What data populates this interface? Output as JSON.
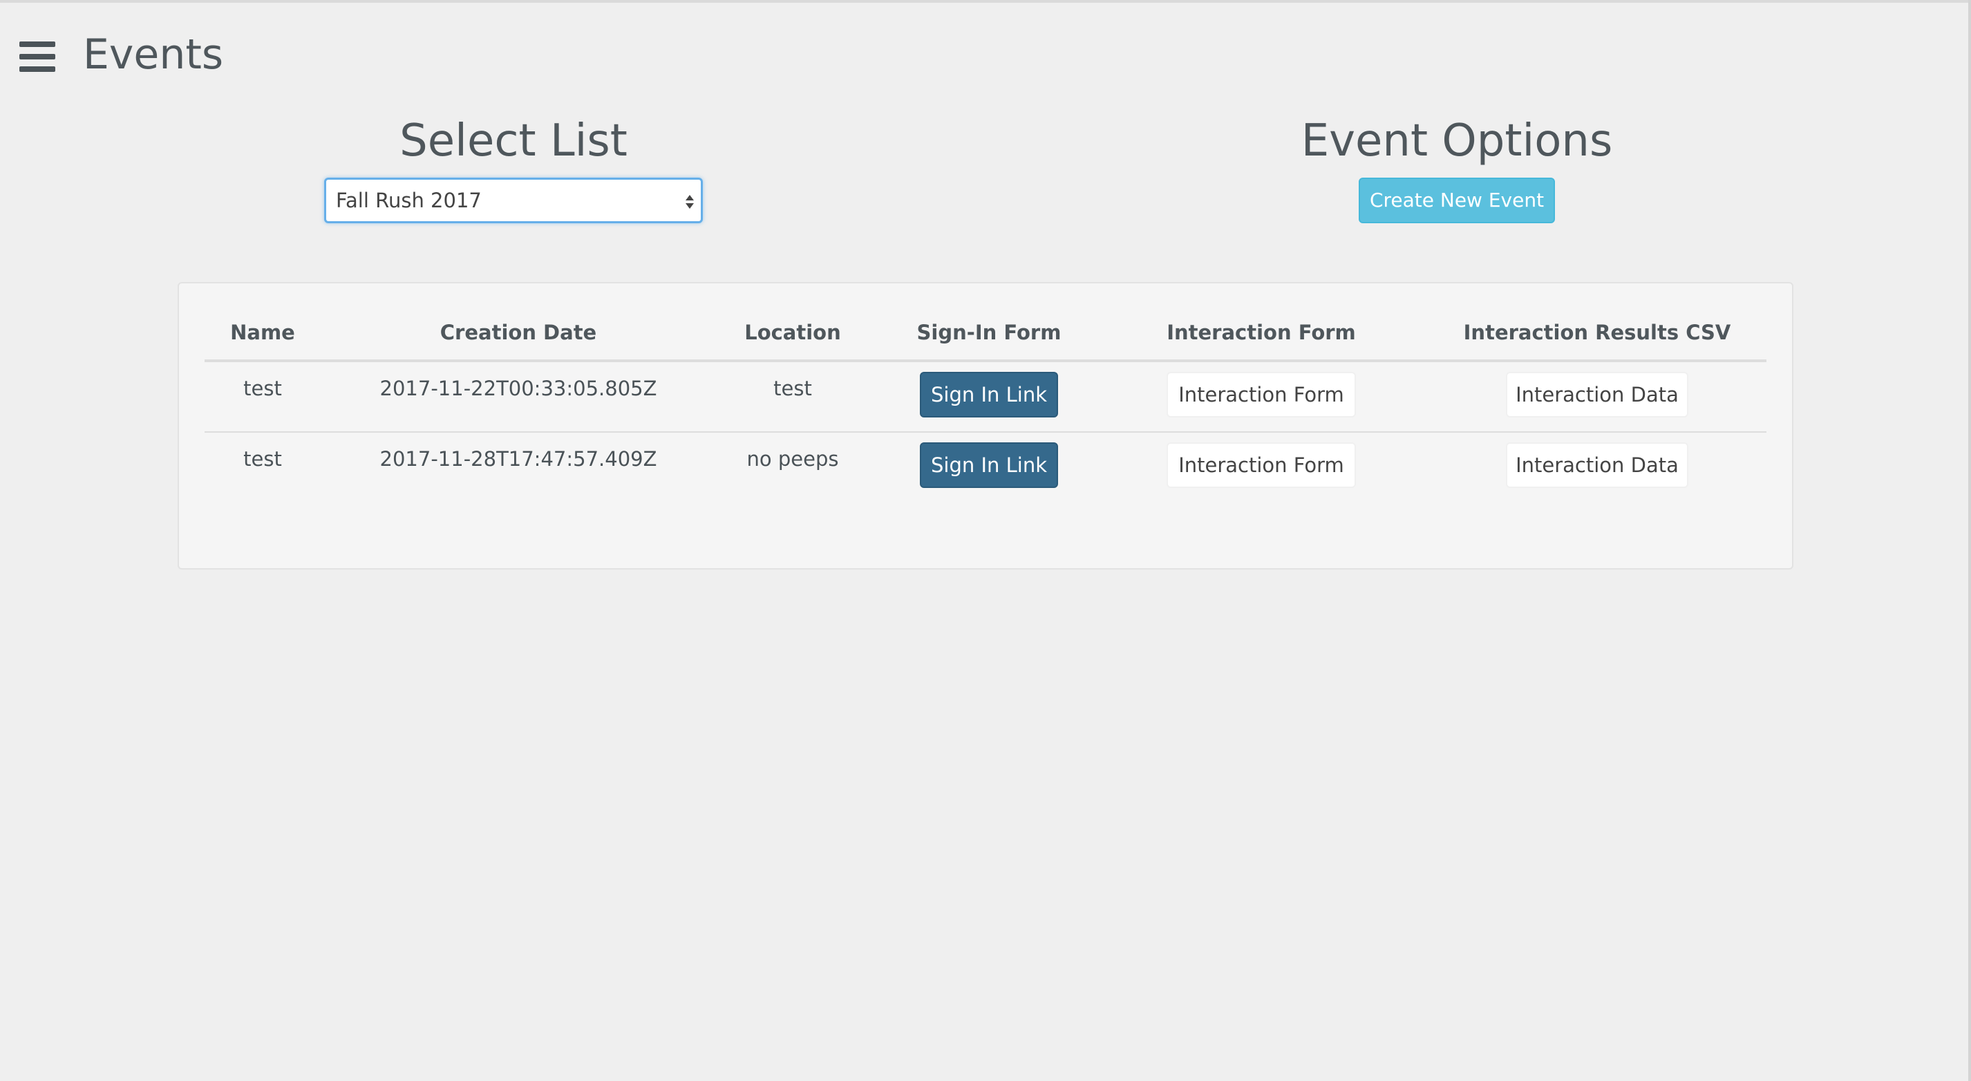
{
  "header": {
    "title": "Events",
    "menu_icon": "hamburger-menu-icon"
  },
  "select_section": {
    "heading": "Select List",
    "selected_value": "Fall Rush 2017"
  },
  "options_section": {
    "heading": "Event Options",
    "create_button_label": "Create New Event"
  },
  "table": {
    "columns": [
      "Name",
      "Creation Date",
      "Location",
      "Sign-In Form",
      "Interaction Form",
      "Interaction Results CSV"
    ],
    "rows": [
      {
        "name": "test",
        "creation_date": "2017-11-22T00:33:05.805Z",
        "location": "test",
        "signin_label": "Sign In Link",
        "form_label": "Interaction Form",
        "data_label": "Interaction Data"
      },
      {
        "name": "test",
        "creation_date": "2017-11-28T17:47:57.409Z",
        "location": "no peeps",
        "signin_label": "Sign In Link",
        "form_label": "Interaction Form",
        "data_label": "Interaction Data"
      }
    ]
  },
  "colors": {
    "background": "#efefef",
    "accent_info": "#5bc0de",
    "primary_dark": "#35698c",
    "focus_border": "#66afe9"
  }
}
